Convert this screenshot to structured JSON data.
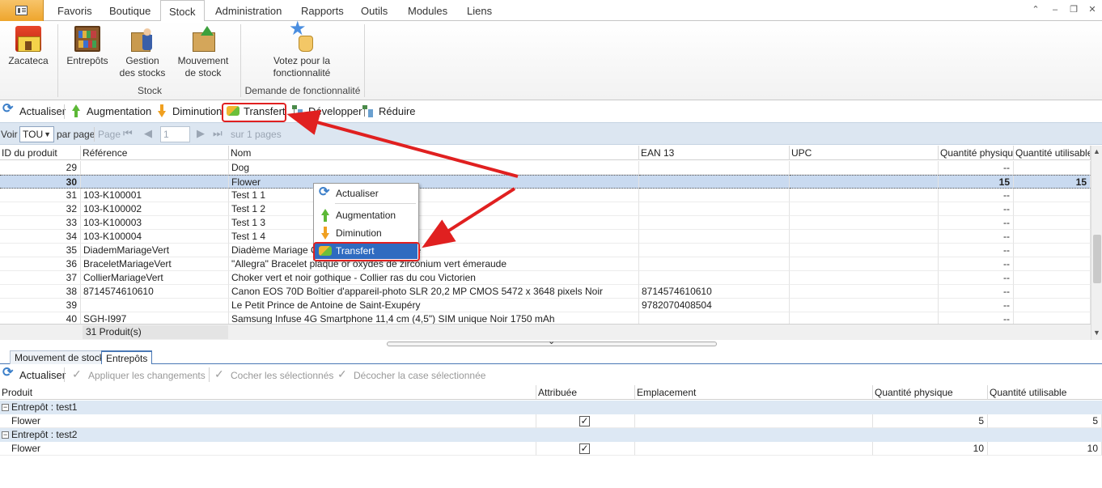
{
  "menu": {
    "tabs": [
      "Favoris",
      "Boutique",
      "Stock",
      "Administration",
      "Rapports",
      "Outils",
      "Modules",
      "Liens"
    ],
    "active_tab": "Stock"
  },
  "ribbon": {
    "zacateca": "Zacateca",
    "entrepots": "Entrepôts",
    "gestion_line1": "Gestion",
    "gestion_line2": "des stocks",
    "mouvement_line1": "Mouvement",
    "mouvement_line2": "de stock",
    "group_stock": "Stock",
    "votez_line1": "Votez pour la",
    "votez_line2": "fonctionnalité",
    "group_demande": "Demande de fonctionnalité"
  },
  "toolbar": {
    "actualiser": "Actualiser",
    "augmentation": "Augmentation",
    "diminution": "Diminution",
    "transfert": "Transfert",
    "developper": "Développer",
    "reduire": "Réduire"
  },
  "pager": {
    "voir": "Voir",
    "per_page_value": "TOU",
    "par_page": "par page",
    "page": "Page",
    "page_value": "1",
    "sur_pages": "sur 1 pages"
  },
  "grid": {
    "columns": [
      "ID du produit",
      "Référence",
      "Nom",
      "EAN 13",
      "UPC",
      "Quantité physique",
      "Quantité utilisable"
    ],
    "rows": [
      {
        "id": "29",
        "ref": "",
        "nom": "Dog",
        "ean": "",
        "upc": "",
        "qp": "--",
        "qu": ""
      },
      {
        "id": "30",
        "ref": "",
        "nom": "Flower",
        "ean": "",
        "upc": "",
        "qp": "15",
        "qu": "15"
      },
      {
        "id": "31",
        "ref": "103-K100001",
        "nom": "Test 1 1",
        "ean": "",
        "upc": "",
        "qp": "--",
        "qu": ""
      },
      {
        "id": "32",
        "ref": "103-K100002",
        "nom": "Test 1 2",
        "ean": "",
        "upc": "",
        "qp": "--",
        "qu": ""
      },
      {
        "id": "33",
        "ref": "103-K100003",
        "nom": "Test 1 3",
        "ean": "",
        "upc": "",
        "qp": "--",
        "qu": ""
      },
      {
        "id": "34",
        "ref": "103-K100004",
        "nom": "Test 1 4",
        "ean": "",
        "upc": "",
        "qp": "--",
        "qu": ""
      },
      {
        "id": "35",
        "ref": "DiademMariageVert",
        "nom": "Diadème Mariage Couronne Vert Émeraude",
        "ean": "",
        "upc": "",
        "qp": "--",
        "qu": ""
      },
      {
        "id": "36",
        "ref": "BraceletMariageVert",
        "nom": "\"Allegra\" Bracelet plaqué or oxydes de zirconium vert émeraude",
        "ean": "",
        "upc": "",
        "qp": "--",
        "qu": ""
      },
      {
        "id": "37",
        "ref": "CollierMariageVert",
        "nom": "Choker vert et noir gothique - Collier ras du cou Victorien",
        "ean": "",
        "upc": "",
        "qp": "--",
        "qu": ""
      },
      {
        "id": "38",
        "ref": "8714574610610",
        "nom": "Canon EOS 70D Boîtier d'appareil-photo SLR 20,2 MP CMOS 5472 x 3648 pixels Noir",
        "ean": "8714574610610",
        "upc": "",
        "qp": "--",
        "qu": ""
      },
      {
        "id": "39",
        "ref": "",
        "nom": "Le Petit Prince de Antoine de Saint-Exupéry",
        "ean": "9782070408504",
        "upc": "",
        "qp": "--",
        "qu": ""
      },
      {
        "id": "40",
        "ref": "SGH-I997",
        "nom": "Samsung Infuse 4G Smartphone 11,4 cm (4,5\") SIM unique Noir 1750 mAh",
        "ean": "",
        "upc": "",
        "qp": "--",
        "qu": ""
      }
    ],
    "footer_count": "31 Produit(s)"
  },
  "context_menu": {
    "actualiser": "Actualiser",
    "augmentation": "Augmentation",
    "diminution": "Diminution",
    "transfert": "Transfert"
  },
  "bottom_tabs": {
    "mouvement": "Mouvement de stock",
    "entrepots": "Entrepôts"
  },
  "bottom_toolbar": {
    "actualiser": "Actualiser",
    "appliquer": "Appliquer les changements",
    "cocher": "Cocher les sélectionnés",
    "decocher": "Décocher la case sélectionnée"
  },
  "bottom_grid": {
    "columns": [
      "Produit",
      "Attribuée",
      "Emplacement",
      "Quantité physique",
      "Quantité utilisable"
    ],
    "groups": [
      {
        "label": "Entrepôt : test1",
        "product": "Flower",
        "qp": "5",
        "qu": "5"
      },
      {
        "label": "Entrepôt : test2",
        "product": "Flower",
        "qp": "10",
        "qu": "10"
      }
    ]
  },
  "colors": {
    "accent": "#2f6bc0",
    "annotation": "#e02020",
    "selected_row": "#c9daf0"
  }
}
